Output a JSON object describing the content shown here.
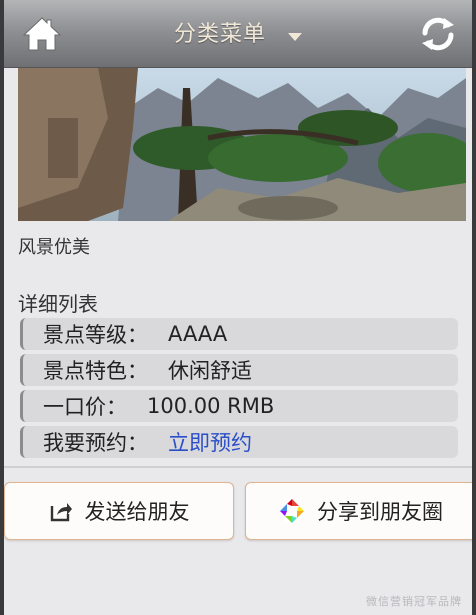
{
  "header": {
    "title": "分类菜单",
    "home_icon": "home-icon",
    "refresh_icon": "refresh-icon",
    "menu_icon": "caret-down-icon"
  },
  "banner": {
    "caption": "风景优美"
  },
  "details": {
    "section_title": "详细列表",
    "rows": [
      {
        "label": "景点等级：",
        "value": "AAAA"
      },
      {
        "label": "景点特色：",
        "value": "休闲舒适"
      },
      {
        "label": "一口价：",
        "value": "100.00 RMB"
      },
      {
        "label": "我要预约：",
        "value": "立即预约"
      }
    ]
  },
  "actions": {
    "send_label": "发送给朋友",
    "share_label": "分享到朋友圈"
  },
  "watermark": "微信营销冠军品牌",
  "colors": {
    "link": "#2a4fc8",
    "header": "#8f9093",
    "button_border": "#e0b48f"
  }
}
